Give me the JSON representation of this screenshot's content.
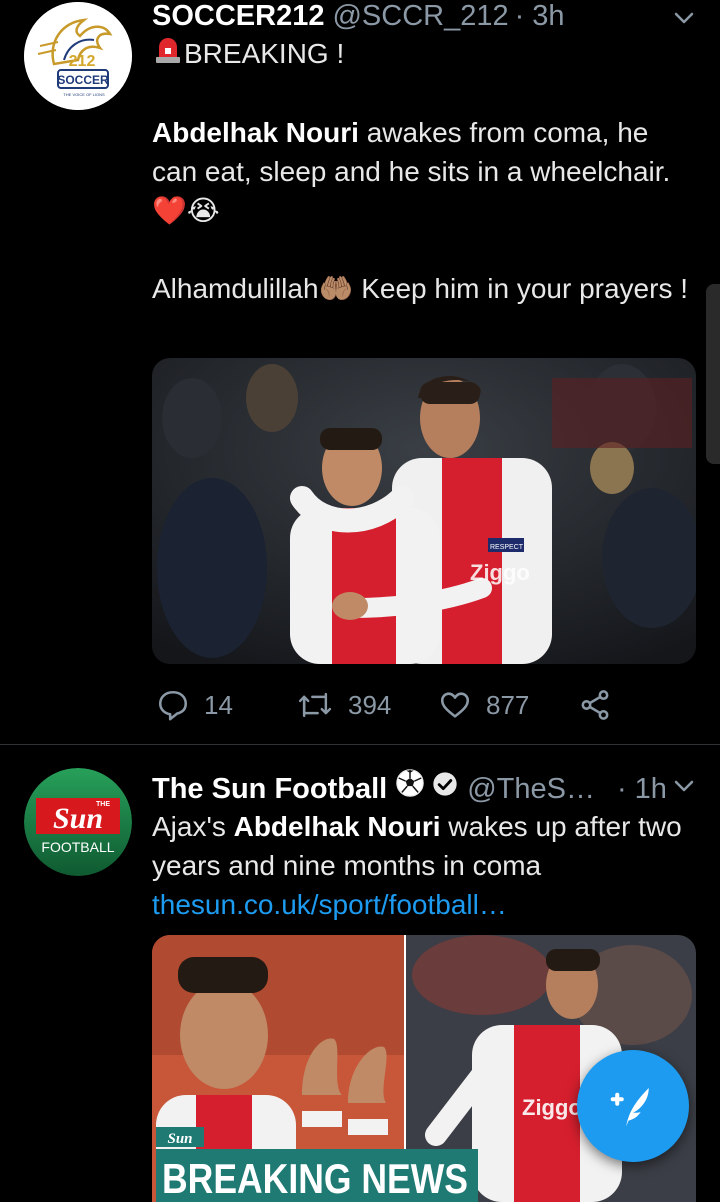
{
  "tweets": [
    {
      "author": "SOCCER212",
      "handle": "@SCCR_212",
      "time": "· 3h",
      "avatar_text": "SOCCER",
      "avatar_logo": "212",
      "avatar_tagline": "THE VOICE OF LIONS",
      "breaking": "BREAKING !",
      "body_bold": "Abdelhak Nouri",
      "body_rest": " awakes from coma, he can eat, sleep and he sits in a wheelchair. ",
      "body_emoji": "❤️😭",
      "body2_a": "Alhamdulillah",
      "body2_emoji": "🤲🏽",
      "body2_b": " Keep him in your prayers !",
      "jersey_text": "Ziggo",
      "sleeve_badge": "RESPECT",
      "replies": "14",
      "retweets": "394",
      "likes": "877"
    },
    {
      "author": "The Sun Football",
      "handle": "@TheS…",
      "time": "· 1h",
      "avatar_brand": "Sun",
      "avatar_sub": "FOOTBALL",
      "avatar_the": "THE",
      "body_a": "Ajax's ",
      "body_bold": "Abdelhak Nouri",
      "body_b": " wakes up after two years and nine months in coma",
      "link": "thesun.co.uk/sport/football…",
      "media_logo": "Sun",
      "media_banner": "BREAKING NEWS",
      "media_jersey": "Ziggo"
    }
  ],
  "colors": {
    "accent": "#1d9bf0",
    "muted": "#8b98a5",
    "background": "#000000",
    "divider": "#2f3336",
    "sun_red": "#d7191d",
    "sun_green": "#1f8a4c"
  },
  "icons": [
    "chevron-down-icon",
    "reply-icon",
    "retweet-icon",
    "like-icon",
    "share-icon",
    "soccer-ball-icon",
    "verified-icon",
    "compose-icon",
    "siren-icon"
  ]
}
